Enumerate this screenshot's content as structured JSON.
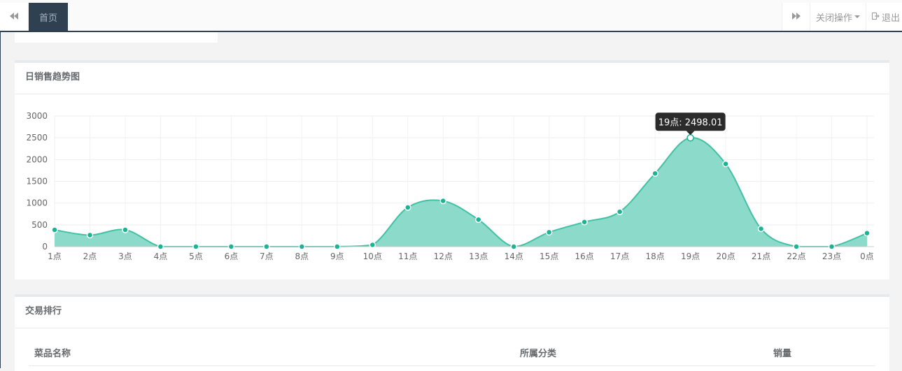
{
  "topbar": {
    "active_tab": "首页",
    "close_ops_label": "关闭操作",
    "logout_label": "退出"
  },
  "sales_panel": {
    "title": "日销售趋势图"
  },
  "rank_panel": {
    "title": "交易排行",
    "columns": [
      "菜品名称",
      "所属分类",
      "销量"
    ]
  },
  "colors": {
    "line": "#43c1a5",
    "area": "#7fd6c3",
    "point": "#1ab394",
    "nav_dark": "#2f4050"
  },
  "chart_data": {
    "type": "area",
    "title": "",
    "xlabel": "",
    "ylabel": "",
    "categories": [
      "1点",
      "2点",
      "3点",
      "4点",
      "5点",
      "6点",
      "7点",
      "8点",
      "9点",
      "10点",
      "11点",
      "12点",
      "13点",
      "14点",
      "15点",
      "16点",
      "17点",
      "18点",
      "19点",
      "20点",
      "21点",
      "22点",
      "23点",
      "0点"
    ],
    "values": [
      385,
      265,
      385,
      0,
      0,
      0,
      0,
      0,
      0,
      40,
      900,
      1050,
      620,
      0,
      330,
      565,
      800,
      1680,
      2498.01,
      1900,
      410,
      0,
      0,
      310
    ],
    "ylim": [
      0,
      3000
    ],
    "yticks": [
      0,
      500,
      1000,
      1500,
      2000,
      2500,
      3000
    ],
    "grid": true,
    "tooltip": {
      "label": "19点: 2498.01",
      "index": 18
    }
  }
}
